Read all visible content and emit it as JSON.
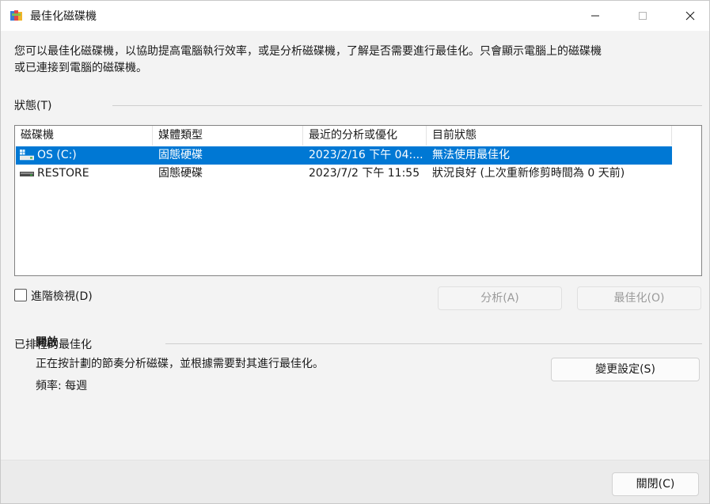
{
  "window": {
    "title": "最佳化磁碟機"
  },
  "description": {
    "line1": "您可以最佳化磁碟機，以協助提高電腦執行效率，或是分析磁碟機，了解是否需要進行最佳化。只會顯示電腦上的磁碟機",
    "line2": "或已連接到電腦的磁碟機。"
  },
  "status_section": {
    "label": "狀態(T)",
    "columns": [
      "磁碟機",
      "媒體類型",
      "最近的分析或優化",
      "目前狀態"
    ],
    "drives": [
      {
        "name": "OS (C:)",
        "media_type": "固態硬碟",
        "last_run": "2023/2/16 下午 04:...",
        "status": "無法使用最佳化",
        "selected": true,
        "icon": "windows-drive-icon"
      },
      {
        "name": "RESTORE",
        "media_type": "固態硬碟",
        "last_run": "2023/7/2 下午 11:55",
        "status": "狀況良好 (上次重新修剪時間為 0 天前)",
        "selected": false,
        "icon": "drive-icon"
      }
    ]
  },
  "advanced_view": {
    "label": "進階檢視(D)",
    "checked": false
  },
  "buttons": {
    "analyze": "分析(A)",
    "optimize": "最佳化(O)",
    "change_settings": "變更設定(S)",
    "close": "關閉(C)"
  },
  "scheduled": {
    "label": "已排程的最佳化",
    "state": "開啟",
    "description": "正在按計劃的節奏分析磁碟，並根據需要對其進行最佳化。",
    "frequency": "頻率: 每週"
  },
  "colors": {
    "selection": "#0078d4",
    "window_bg": "#f3f3f3"
  }
}
